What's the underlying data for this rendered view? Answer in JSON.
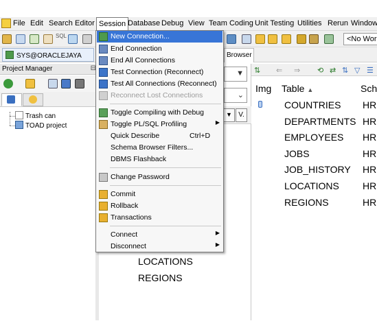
{
  "menubar": {
    "items": [
      "File",
      "Edit",
      "Search",
      "Editor",
      "Session",
      "Database",
      "Debug",
      "View",
      "Team Coding",
      "Unit Testing",
      "Utilities",
      "Rerun",
      "Window"
    ]
  },
  "toolbar": {
    "workspace": "<No Work",
    "sql_label": "SQL"
  },
  "connection": {
    "tab_label": "SYS@ORACLEJAYA",
    "browser_tab": "Browser"
  },
  "project_manager": {
    "title": "Project Manager",
    "pin": "⊟",
    "tree": [
      "Trash can",
      "TOAD project"
    ]
  },
  "session_menu": {
    "items": [
      {
        "label": "New Connection...",
        "state": "highlight"
      },
      {
        "label": "End Connection",
        "state": "normal"
      },
      {
        "label": "End All Connections",
        "state": "normal"
      },
      {
        "label": "Test Connection (Reconnect)",
        "state": "normal"
      },
      {
        "label": "Test All Connections (Reconnect)",
        "state": "normal"
      },
      {
        "label": "Reconnect Lost Connections",
        "state": "disabled"
      },
      {
        "label": "Toggle Compiling with Debug",
        "state": "normal"
      },
      {
        "label": "Toggle PL/SQL Profiling",
        "state": "normal",
        "submenu": true
      },
      {
        "label": "Quick Describe",
        "state": "normal",
        "shortcut": "Ctrl+D"
      },
      {
        "label": "Schema Browser Filters...",
        "state": "normal"
      },
      {
        "label": "DBMS Flashback",
        "state": "normal"
      },
      {
        "label": "Change Password",
        "state": "normal"
      },
      {
        "label": "Commit",
        "state": "normal"
      },
      {
        "label": "Rollback",
        "state": "normal"
      },
      {
        "label": "Transactions",
        "state": "normal"
      },
      {
        "label": "Connect",
        "state": "normal",
        "submenu": true
      },
      {
        "label": "Disconnect",
        "state": "normal",
        "submenu": true
      }
    ]
  },
  "middle": {
    "strip_button": "V.",
    "visible_items": [
      "LOCATIONS",
      "REGIONS"
    ]
  },
  "grid": {
    "columns": [
      "Img",
      "Table",
      "Sch"
    ],
    "sort_indicator": "▲",
    "rows": [
      {
        "table": "COUNTRIES",
        "schema": "HR"
      },
      {
        "table": "DEPARTMENTS",
        "schema": "HR"
      },
      {
        "table": "EMPLOYEES",
        "schema": "HR"
      },
      {
        "table": "JOBS",
        "schema": "HR"
      },
      {
        "table": "JOB_HISTORY",
        "schema": "HR"
      },
      {
        "table": "LOCATIONS",
        "schema": "HR"
      },
      {
        "table": "REGIONS",
        "schema": "HR"
      }
    ]
  },
  "colors": {
    "highlight": "#3875d7",
    "menu_bg": "#f7f7f7",
    "chrome": "#f0f0f0"
  }
}
